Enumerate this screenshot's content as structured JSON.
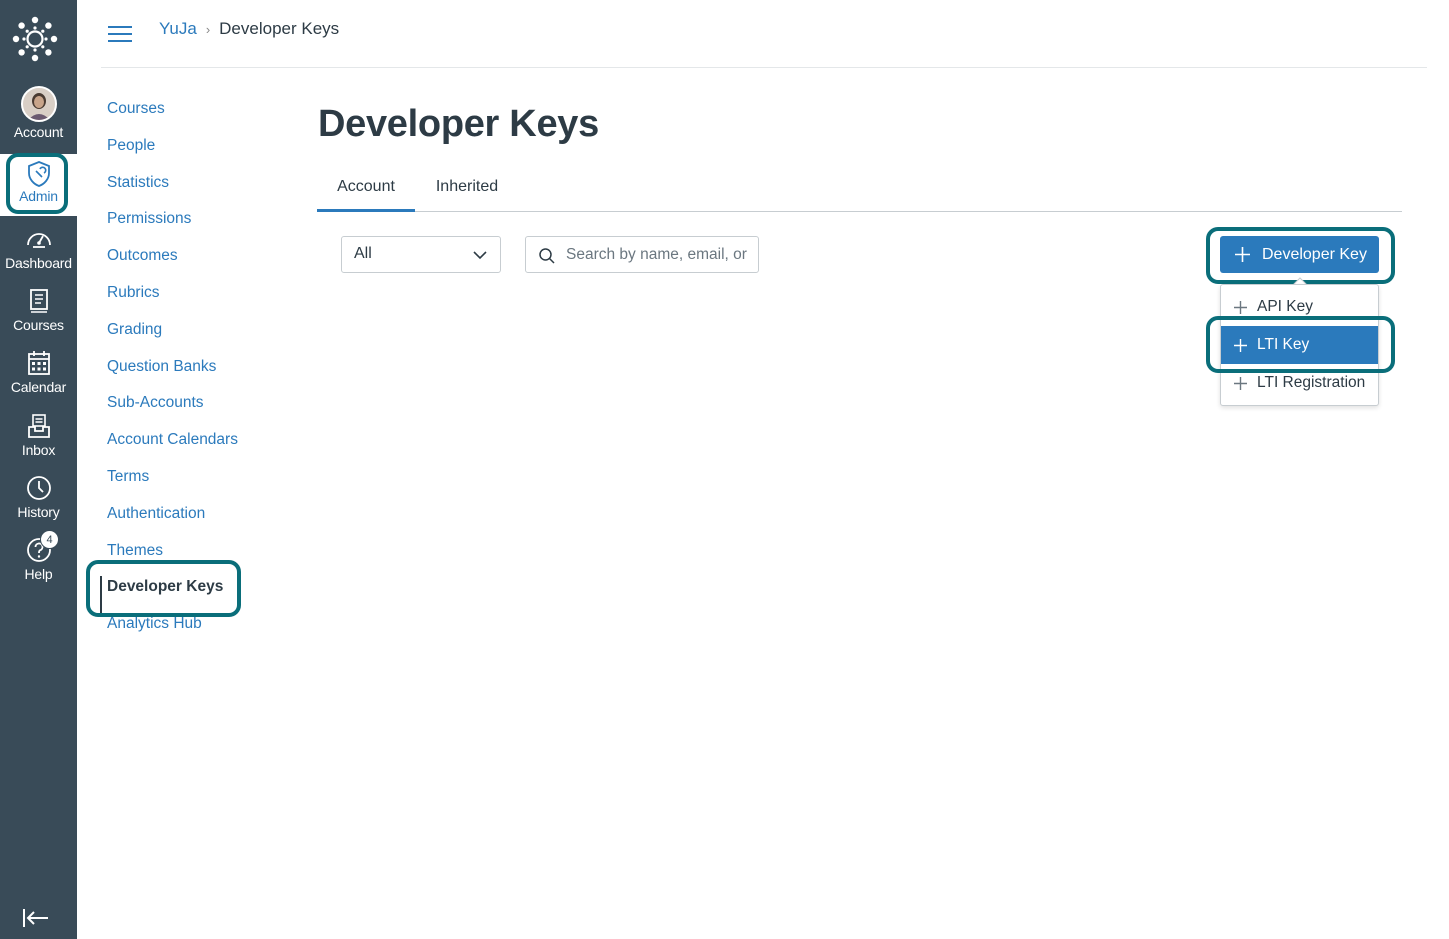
{
  "global_nav": {
    "items": [
      {
        "label": "Account",
        "icon": "avatar"
      },
      {
        "label": "Admin",
        "icon": "shield-icon"
      },
      {
        "label": "Dashboard",
        "icon": "speedometer-icon"
      },
      {
        "label": "Courses",
        "icon": "book-icon"
      },
      {
        "label": "Calendar",
        "icon": "calendar-icon"
      },
      {
        "label": "Inbox",
        "icon": "inbox-icon"
      },
      {
        "label": "History",
        "icon": "clock-icon"
      },
      {
        "label": "Help",
        "icon": "question-icon"
      }
    ],
    "help_badge": "4",
    "colors": {
      "nav_bg": "#394b58",
      "accent": "#2b7abc",
      "highlight_ring": "#0a6e7a"
    }
  },
  "breadcrumb": {
    "parent": "YuJa",
    "current": "Developer Keys"
  },
  "subnav": {
    "items": [
      "Courses",
      "People",
      "Statistics",
      "Permissions",
      "Outcomes",
      "Rubrics",
      "Grading",
      "Question Banks",
      "Sub-Accounts",
      "Account Calendars",
      "Terms",
      "Authentication",
      "Themes",
      "Developer Keys",
      "Analytics Hub"
    ],
    "active": "Developer Keys"
  },
  "main": {
    "title": "Developer Keys",
    "tabs": [
      "Account",
      "Inherited"
    ],
    "active_tab": "Account",
    "filter_value": "All",
    "search_placeholder": "Search by name, email, or ID",
    "developer_key_button": "Developer Key",
    "menu_items": [
      "API Key",
      "LTI Key",
      "LTI Registration"
    ],
    "menu_active": "LTI Key"
  }
}
